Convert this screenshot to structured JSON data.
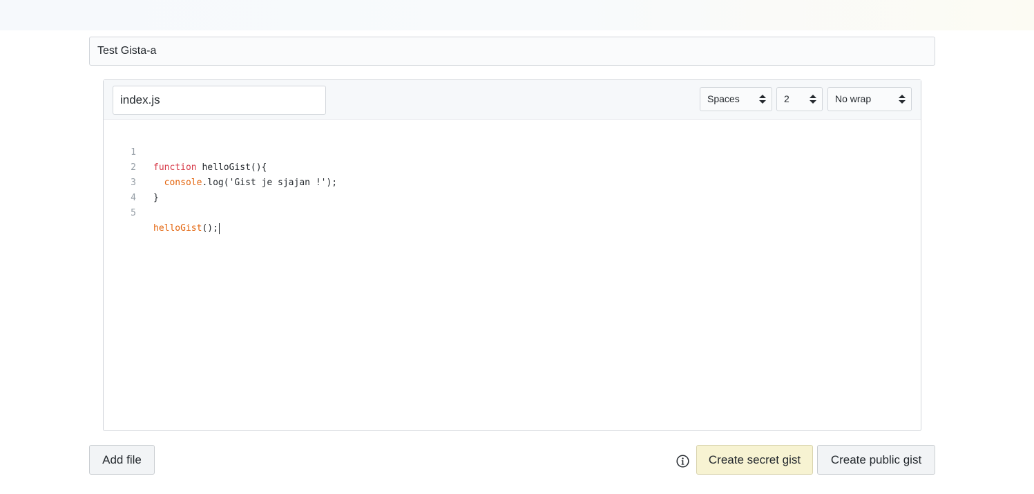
{
  "gist": {
    "description": "Test Gista-a",
    "filename": "index.js"
  },
  "editor": {
    "indent_mode": "Spaces",
    "indent_size": "2",
    "wrap_mode": "No wrap",
    "lines": [
      {
        "number": "1"
      },
      {
        "number": "2"
      },
      {
        "number": "3"
      },
      {
        "number": "4"
      },
      {
        "number": "5"
      }
    ],
    "tokens": {
      "l1_kw": "function",
      "l1_rest": " helloGist(){",
      "l2_indent": "  ",
      "l2_obj": "console",
      "l2_rest": ".log('Gist je sjajan !');",
      "l3": "}",
      "l5_call": "helloGist",
      "l5_rest": "();"
    }
  },
  "actions": {
    "add_file": "Add file",
    "create_secret": "Create secret gist",
    "create_public": "Create public gist"
  },
  "icons": {
    "info": "info-icon",
    "select_arrows": "up-down-chevron-icon"
  }
}
